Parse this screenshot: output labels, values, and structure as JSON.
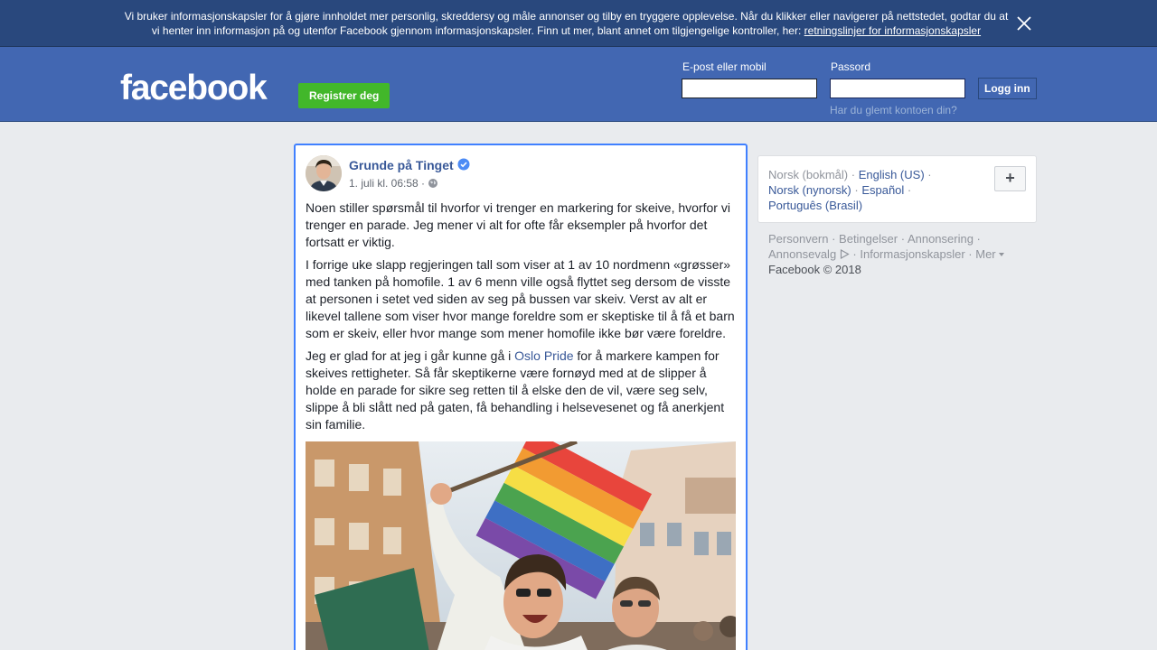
{
  "cookie_banner": {
    "text_line1": "Vi bruker informasjonskapsler for å gjøre innholdet mer personlig, skreddersy og måle annonser og tilby en tryggere opplevelse. Når du klikker eller navigerer på nettstedet, godtar du at",
    "text_line2": "vi henter inn informasjon på og utenfor Facebook gjennom informasjonskapsler. Finn ut mer, blant annet om tilgjengelige kontroller, her: ",
    "policy_link": "retningslinjer for informasjonskapsler",
    "close_icon": "close-icon"
  },
  "header": {
    "logo": "facebook",
    "register_button": "Registrer deg",
    "email_label": "E-post eller mobil",
    "email_value": "",
    "password_label": "Passord",
    "password_value": "",
    "login_button": "Logg inn",
    "forgot_link": "Har du glemt kontoen din?"
  },
  "post": {
    "author": "Grunde på Tinget",
    "verified_icon": "verified-badge-icon",
    "timestamp": "1. juli kl. 06:58 ·",
    "privacy_icon": "globe-icon",
    "paragraph1": "Noen stiller spørsmål til hvorfor vi trenger en markering for skeive, hvorfor vi trenger en parade. Jeg mener vi alt for ofte får eksempler på hvorfor det fortsatt er viktig.",
    "paragraph2": "I forrige uke slapp regjeringen tall som viser at 1 av 10 nordmenn «grøsser» med tanken på homofile. 1 av 6 menn ville også flyttet seg dersom de visste at personen i setet ved siden av seg på bussen var skeiv. Verst av alt er likevel tallene som viser hvor mange foreldre som er skeptiske til å få et barn som er skeiv, eller hvor mange som mener homofile ikke bør være foreldre.",
    "paragraph3_before": "Jeg er glad for at jeg i går kunne gå i ",
    "paragraph3_link": "Oslo Pride",
    "paragraph3_after": " for å markere kampen for skeives rettigheter. Så får skeptikerne være fornøyd med at de slipper å holde en parade for sikre seg retten til å elske den de vil, være seg selv, slippe å bli slått ned på gaten, få behandling i helsevesenet og få anerkjent sin familie."
  },
  "languages": {
    "current": "Norsk (bokmål)",
    "options": [
      "English (US)",
      "Norsk (nynorsk)",
      "Español",
      "Português (Brasil)"
    ],
    "add_button": "+"
  },
  "footer": {
    "links": [
      "Personvern",
      "Betingelser",
      "Annonsering",
      "Annonsevalg",
      "Informasjonskapsler",
      "Mer"
    ],
    "copyright": "Facebook © 2018"
  },
  "colors": {
    "brand_blue": "#4267b2",
    "banner_blue": "#29487d",
    "register_green": "#42b72a",
    "link_blue": "#385898",
    "focus_border": "#4080ff"
  }
}
